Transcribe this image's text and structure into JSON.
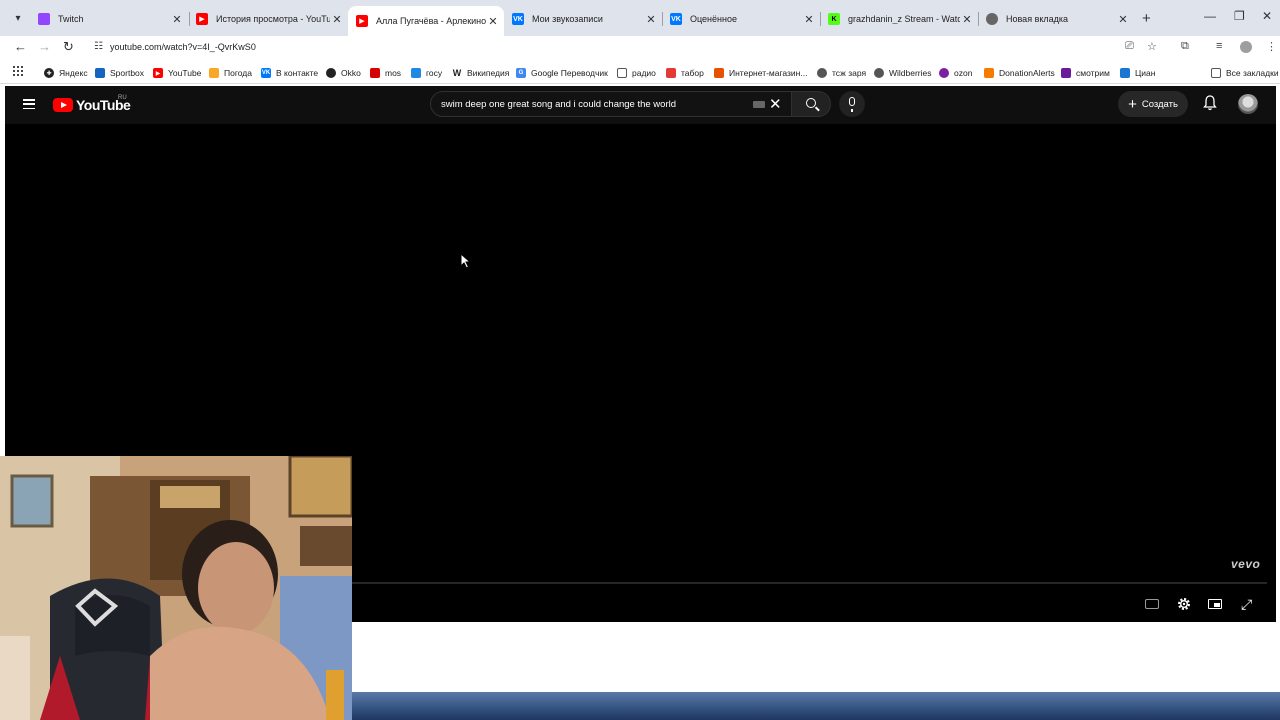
{
  "browser": {
    "tabs": [
      {
        "title": "Twitch",
        "favicon": "twitch-icon",
        "color": "#9146ff",
        "active": false
      },
      {
        "title": "История просмотра - YouTube",
        "favicon": "youtube-icon",
        "color": "#ff0000",
        "active": false
      },
      {
        "title": "Алла Пугачёва - Арлекино (Official Vid",
        "favicon": "youtube-icon",
        "color": "#ff0000",
        "active": true
      },
      {
        "title": "Мои звукозаписи",
        "favicon": "vk-icon",
        "color": "#0077ff",
        "active": false
      },
      {
        "title": "Оценённое",
        "favicon": "vk-icon",
        "color": "#0077ff",
        "active": false
      },
      {
        "title": "grazhdanin_z Stream - Watch Live",
        "favicon": "kick-icon",
        "color": "#53fc18",
        "active": false
      },
      {
        "title": "Новая вкладка",
        "favicon": "chrome-icon",
        "color": "#666666",
        "active": false
      }
    ],
    "address": {
      "url": "youtube.com/watch?v=4I_-QvrKwS0"
    },
    "bookmarks": [
      {
        "label": "Яндекс",
        "icon": "yandex-icon",
        "color": "#222222"
      },
      {
        "label": "Sportbox",
        "icon": "sportbox-icon",
        "color": "#1565c0"
      },
      {
        "label": "YouTube",
        "icon": "youtube-icon",
        "color": "#ff0000"
      },
      {
        "label": "Погода",
        "icon": "weather-icon",
        "color": "#f9a825"
      },
      {
        "label": "В контакте",
        "icon": "vk-icon",
        "color": "#0077ff"
      },
      {
        "label": "Okko",
        "icon": "okko-icon",
        "color": "#222222"
      },
      {
        "label": "mos",
        "icon": "mos-icon",
        "color": "#d50000"
      },
      {
        "label": "госу",
        "icon": "gosuslugi-icon",
        "color": "#1e88e5"
      },
      {
        "label": "Википедия",
        "icon": "wikipedia-icon",
        "color": "#444444"
      },
      {
        "label": "Google Переводчик",
        "icon": "translate-icon",
        "color": "#4285f4"
      },
      {
        "label": "радио",
        "icon": "folder-icon",
        "color": "#555555"
      },
      {
        "label": "табор",
        "icon": "tabor-icon",
        "color": "#e53935"
      },
      {
        "label": "Интернет-магазин...",
        "icon": "shop-icon",
        "color": "#e65100"
      },
      {
        "label": "тсж заря",
        "icon": "globe-icon",
        "color": "#555555"
      },
      {
        "label": "Wildberries",
        "icon": "globe-icon",
        "color": "#555555"
      },
      {
        "label": "ozon",
        "icon": "ozon-icon",
        "color": "#7b1fa2"
      },
      {
        "label": "DonationAlerts",
        "icon": "donationalerts-icon",
        "color": "#f57c00"
      },
      {
        "label": "смотрим",
        "icon": "smotrim-icon",
        "color": "#6a1b9a"
      },
      {
        "label": "Циан",
        "icon": "cian-icon",
        "color": "#1976d2"
      }
    ],
    "all_bookmarks_label": "Все закладки"
  },
  "youtube": {
    "logo_text": "YouTube",
    "region": "RU",
    "search_query": "swim deep one great song and i could change the world",
    "create_label": "Создать"
  },
  "player": {
    "watermark": "vevo"
  }
}
